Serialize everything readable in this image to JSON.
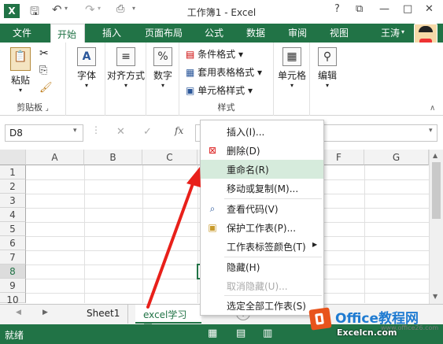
{
  "title": "工作簿1 - Excel",
  "titlebar": {
    "help": "?",
    "minimize": "—",
    "restore": "□",
    "close": "✕"
  },
  "tabs": [
    "文件",
    "开始",
    "插入",
    "页面布局",
    "公式",
    "数据",
    "审阅",
    "视图"
  ],
  "user": "王涛",
  "ribbon": {
    "paste": "粘贴",
    "clipboard": "剪贴板",
    "font": "字体",
    "align": "对齐方式",
    "number": "数字",
    "cond_format": "条件格式",
    "table_format": "套用表格格式",
    "cell_style": "单元格样式",
    "styles": "样式",
    "cells": "单元格",
    "edit": "编辑",
    "pct": "%"
  },
  "namebox": "D8",
  "fx": "fx",
  "columns": [
    "A",
    "B",
    "C",
    "D",
    "E",
    "F",
    "G"
  ],
  "rows": [
    "1",
    "2",
    "3",
    "4",
    "5",
    "6",
    "7",
    "8",
    "9",
    "10"
  ],
  "sheets": [
    "Sheet1",
    "excel学习网"
  ],
  "status": "就绪",
  "menu": {
    "items": [
      {
        "label": "插入(I)...",
        "icon": ""
      },
      {
        "label": "删除(D)",
        "icon": "delete-sheet-icon"
      },
      {
        "label": "重命名(R)",
        "icon": "",
        "highlight": true
      },
      {
        "label": "移动或复制(M)...",
        "icon": ""
      },
      {
        "label": "查看代码(V)",
        "icon": "view-code-icon"
      },
      {
        "label": "保护工作表(P)...",
        "icon": "protect-sheet-icon"
      },
      {
        "label": "工作表标签颜色(T)",
        "icon": "",
        "submenu": true
      },
      {
        "label": "隐藏(H)",
        "icon": ""
      },
      {
        "label": "取消隐藏(U)...",
        "icon": "",
        "disabled": true
      },
      {
        "label": "选定全部工作表(S)",
        "icon": ""
      }
    ]
  },
  "watermark": {
    "brand": "Office教程网",
    "url": "www.office26.com",
    "site": "Excelcn.com"
  },
  "colors": {
    "accent": "#217346",
    "highlight": "#d6ebdc",
    "arrow": "#e8201a"
  }
}
